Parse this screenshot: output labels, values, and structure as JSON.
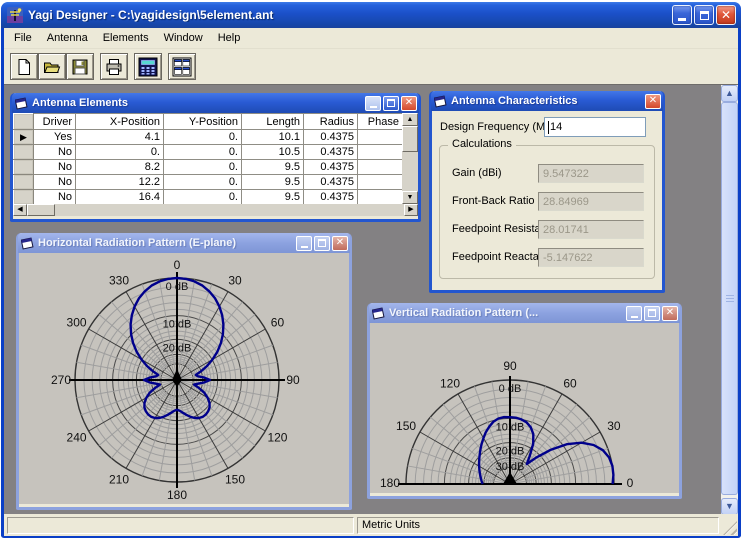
{
  "app": {
    "title": "Yagi Designer - C:\\yagidesign\\5element.ant",
    "menu": [
      "File",
      "Antenna",
      "Elements",
      "Window",
      "Help"
    ],
    "toolbar_icons": [
      "new-file-icon",
      "open-folder-icon",
      "save-icon",
      "print-icon",
      "calculator-icon",
      "tile-windows-icon"
    ],
    "status_right": "Metric Units"
  },
  "elements_window": {
    "title": "Antenna Elements",
    "columns": [
      "Driver",
      "X-Position",
      "Y-Position",
      "Length",
      "Radius",
      "Phase"
    ],
    "rows": [
      [
        "Yes",
        "4.1",
        "0.",
        "10.1",
        "0.4375",
        ""
      ],
      [
        "No",
        "0.",
        "0.",
        "10.5",
        "0.4375",
        ""
      ],
      [
        "No",
        "8.2",
        "0.",
        "9.5",
        "0.4375",
        ""
      ],
      [
        "No",
        "12.2",
        "0.",
        "9.5",
        "0.4375",
        ""
      ],
      [
        "No",
        "16.4",
        "0.",
        "9.5",
        "0.4375",
        ""
      ]
    ],
    "selected_row": 0,
    "row_marker": "▶"
  },
  "characteristics_window": {
    "title": "Antenna Characteristics",
    "frequency_label": "Design Frequency (MHz)",
    "frequency_value": "14",
    "group_title": "Calculations",
    "fields": [
      {
        "label": "Gain (dBi)",
        "value": "9.547322"
      },
      {
        "label": "Front-Back Ratio",
        "value": "28.84969"
      },
      {
        "label": "Feedpoint Resistance",
        "value": "28.01741"
      },
      {
        "label": "Feedpoint Reactance",
        "value": "-5.147622"
      }
    ]
  },
  "horizontal_window": {
    "title": "Horizontal Radiation Pattern (E-plane)"
  },
  "vertical_window": {
    "title": "Vertical Radiation Pattern (..."
  },
  "chart_data": [
    {
      "type": "line",
      "plot": "polar-full",
      "title": "Horizontal Radiation Pattern (E-plane)",
      "angle_labels": [
        0,
        30,
        60,
        90,
        120,
        150,
        180,
        210,
        240,
        270,
        300,
        330
      ],
      "ring_db": [
        0,
        10,
        20
      ],
      "ring_labels": [
        "0 dB",
        "10 dB",
        "20 dB"
      ],
      "minor_ring_step_db": 2,
      "max_db": 40,
      "scale": "r = 10^(-dB/50)",
      "line_color": "#00008B",
      "symmetric_about_0_180": true,
      "db_step5_0_to_180": [
        0,
        0.1,
        0.4,
        0.9,
        1.7,
        2.7,
        4,
        5.6,
        7.5,
        9.8,
        12.5,
        15.8,
        19.8,
        24.5,
        30,
        36,
        34,
        28.5,
        24.5,
        28.5,
        34,
        38,
        32,
        26.5,
        23,
        20.5,
        19,
        18.2,
        17.8,
        17.8,
        18.3,
        19.3,
        20.8,
        22.6,
        24.4,
        26,
        26.8
      ]
    },
    {
      "type": "line",
      "plot": "polar-half",
      "title": "Vertical Radiation Pattern",
      "angle_labels": [
        0,
        30,
        60,
        90,
        120,
        150,
        180
      ],
      "ring_db": [
        0,
        10,
        20,
        30
      ],
      "ring_labels": [
        "0 dB",
        "10 dB",
        "20 dB",
        "30 dB"
      ],
      "minor_ring_step_db": 2,
      "max_db": 40,
      "scale": "r = 10^(-dB/50)",
      "line_color": "#00008B",
      "db_step5_0_to_180": [
        0.3,
        0.05,
        0,
        0.3,
        1.1,
        2.6,
        5,
        8.8,
        14.5,
        22,
        30,
        24,
        17.5,
        13.8,
        11.8,
        10.6,
        10,
        9.7,
        9.6,
        9.5,
        9.7,
        10.4,
        11.6,
        13,
        14.6,
        16.2,
        17.8,
        19.3,
        20.7,
        22,
        23.2,
        24.4,
        25.5,
        26.5,
        27.4,
        28.2,
        29
      ]
    }
  ]
}
